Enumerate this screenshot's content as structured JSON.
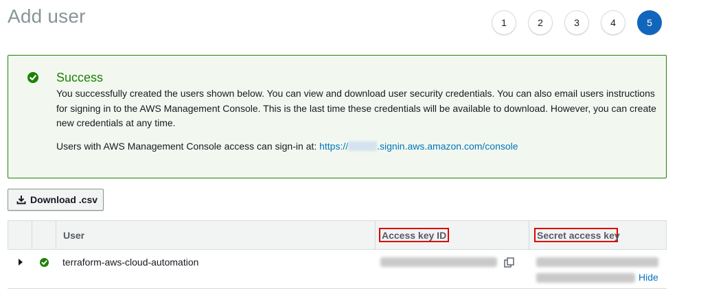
{
  "page": {
    "title": "Add user"
  },
  "steps": [
    "1",
    "2",
    "3",
    "4",
    "5"
  ],
  "active_step": "5",
  "alert": {
    "title": "Success",
    "body": "You successfully created the users shown below. You can view and download user security credentials. You can also email users instructions for signing in to the AWS Management Console. This is the last time these credentials will be available to download. However, you can create new credentials at any time.",
    "signin_prefix": "Users with AWS Management Console access can sign-in at: ",
    "signin_link_start": "https://",
    "signin_link_end": ".signin.aws.amazon.com/console"
  },
  "toolbar": {
    "download_label": "Download .csv"
  },
  "table": {
    "columns": {
      "user": "User",
      "access_key": "Access key ID",
      "secret_key": "Secret access key"
    },
    "rows": [
      {
        "user": "terraform-aws-cloud-automation",
        "secret_action": "Hide"
      }
    ]
  },
  "colors": {
    "success": "#1d8102",
    "accent": "#1166bb",
    "link": "#0073bb",
    "highlight": "#dd0000"
  }
}
